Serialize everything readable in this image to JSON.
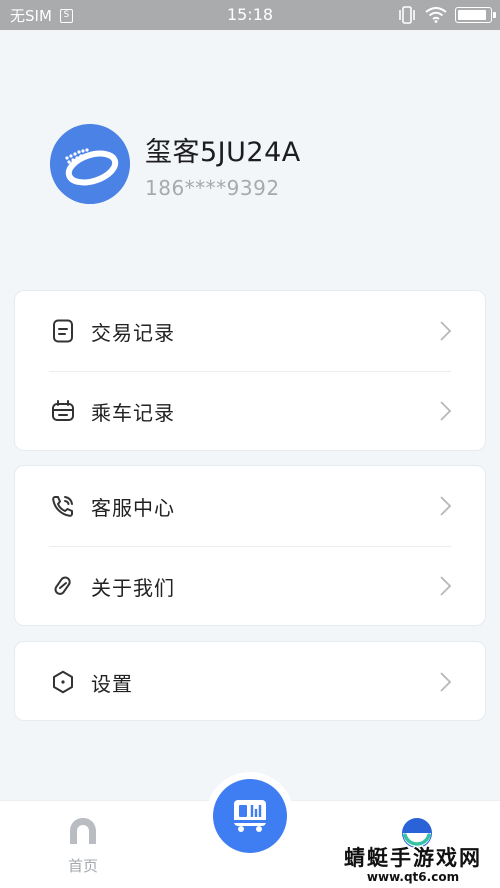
{
  "status_bar": {
    "carrier": "无SIM",
    "sim_icon_text": "S",
    "time": "15:18",
    "battery_level": 0.9
  },
  "profile": {
    "username": "玺客5JU24A",
    "phone": "186****9392",
    "avatar_color": "#4b82e6"
  },
  "menu": {
    "trade_records": "交易记录",
    "ride_records": "乘车记录",
    "customer_service": "客服中心",
    "about_us": "关于我们",
    "settings": "设置"
  },
  "tabbar": {
    "home_label": "首页",
    "accent": "#3f7df2"
  },
  "watermark": {
    "line1": "蜻蜓手游戏网",
    "line2": "www.qt6.com"
  }
}
